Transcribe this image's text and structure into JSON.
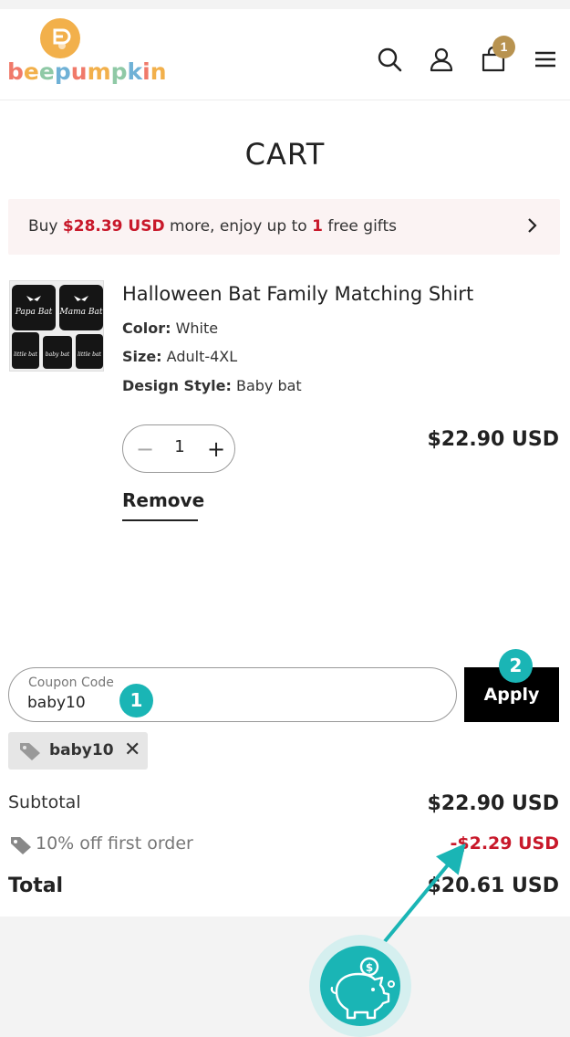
{
  "header": {
    "logo_text": "beepumpkin",
    "cart_count": "1",
    "icons": [
      "search-icon",
      "account-icon",
      "cart-icon",
      "menu-icon"
    ]
  },
  "page_title": "CART",
  "promo": {
    "prefix": "Buy ",
    "amount": "$28.39 USD",
    "middle": " more, enjoy up to ",
    "count": "1",
    "suffix": " free gifts"
  },
  "item": {
    "name": "Halloween Bat Family Matching Shirt",
    "color_label": "Color:",
    "color_value": " White",
    "size_label": "Size:",
    "size_value": " Adult-4XL",
    "design_label": "Design Style:",
    "design_value": " Baby bat",
    "quantity": "1",
    "price": "$22.90 USD",
    "remove_label": "Remove",
    "thumb_labels": [
      "Papa Bat",
      "Mama Bat",
      "little bat",
      "baby bat",
      "little bat"
    ]
  },
  "coupon": {
    "label": "Coupon Code",
    "value": "baby10",
    "apply_label": "Apply",
    "step1": "1",
    "step2": "2",
    "applied_tag": "baby10"
  },
  "summary": {
    "subtotal_label": "Subtotal",
    "subtotal_value": "$22.90 USD",
    "discount_label": "10% off first order",
    "discount_value": "-$2.29 USD",
    "total_label": "Total",
    "total_value": "$20.61 USD"
  },
  "colors": {
    "accent_teal": "#1ab5b5",
    "sale_red": "#c8182a",
    "badge_gold": "#b89350"
  }
}
